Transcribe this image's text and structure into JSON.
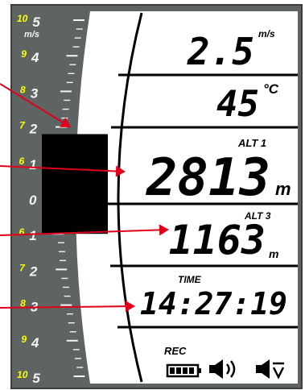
{
  "colors": {
    "bezel": "#5e6462",
    "bezel_edge": "#3a3e3d",
    "scale_yellow": "#ffff00",
    "scale_white": "#f4f4f4",
    "arrow_red": "#e0001b",
    "bar_black": "#000000"
  },
  "vario_scale": {
    "unit": "m/s",
    "labels": [
      {
        "yellow": "10",
        "white": "5"
      },
      {
        "yellow": "9",
        "white": "4"
      },
      {
        "yellow": "8",
        "white": "3"
      },
      {
        "yellow": "7",
        "white": "2"
      },
      {
        "yellow": "6",
        "white": "1"
      },
      {
        "yellow": "",
        "white": "0"
      },
      {
        "yellow": "6",
        "white": "1"
      },
      {
        "yellow": "7",
        "white": "2"
      },
      {
        "yellow": "8",
        "white": "3"
      },
      {
        "yellow": "9",
        "white": "4"
      },
      {
        "yellow": "10",
        "white": "5"
      }
    ],
    "bar_from_ms": 1.8,
    "bar_to_ms": -1.0
  },
  "fields": {
    "vario": {
      "value": "2.5",
      "unit": "m/s"
    },
    "temperature": {
      "value": "45",
      "unit": "°C"
    },
    "alt1": {
      "label": "ALT 1",
      "value": "2813",
      "unit": "m"
    },
    "alt3": {
      "label": "ALT 3",
      "value": "1163",
      "unit": "m"
    },
    "time": {
      "label": "TIME",
      "value": "14:27:19"
    },
    "status": {
      "label": "REC",
      "battery_icon": "battery-full-icon",
      "speaker_icon": "speaker-on-icon",
      "speaker_vario_icon": "speaker-vario-down-icon"
    }
  }
}
